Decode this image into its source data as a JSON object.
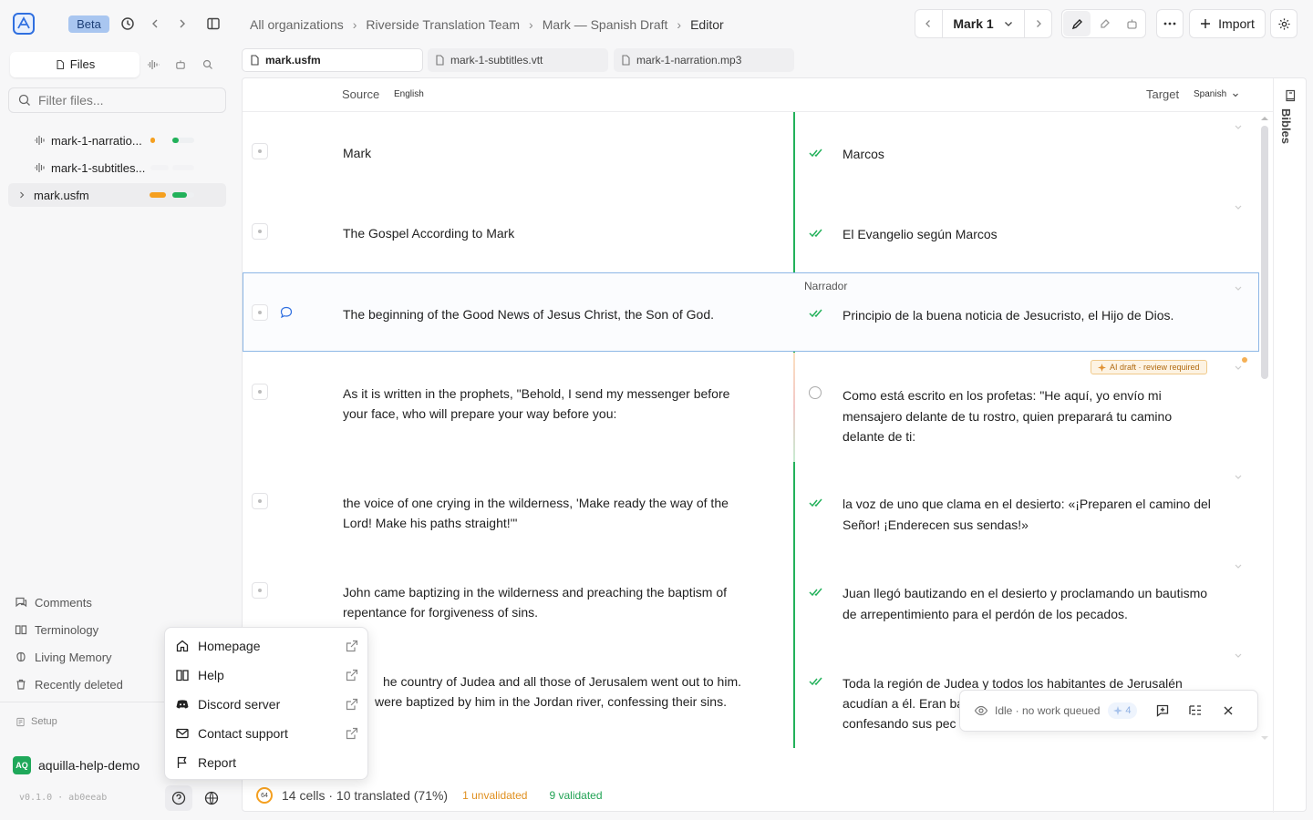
{
  "header": {
    "beta_label": "Beta",
    "breadcrumbs": [
      "All organizations",
      "Riverside Translation Team",
      "Mark — Spanish Draft",
      "Editor"
    ],
    "chapter_select": "Mark 1",
    "import_label": "Import"
  },
  "sidebar": {
    "tab_files": "Files",
    "filter_placeholder": "Filter files...",
    "files": [
      {
        "name": "mark-1-narratio..."
      },
      {
        "name": "mark-1-subtitles..."
      },
      {
        "name": "mark.usfm"
      }
    ],
    "nav": [
      {
        "label": "Comments"
      },
      {
        "label": "Terminology"
      },
      {
        "label": "Living Memory"
      },
      {
        "label": "Recently deleted"
      }
    ],
    "setup_label": "Setup",
    "workspace": {
      "badge": "AQ",
      "name": "aquilla-help-demo"
    },
    "version": "v0.1.0 · ab0eeab"
  },
  "file_tabs": [
    {
      "name": "mark.usfm"
    },
    {
      "name": "mark-1-subtitles.vtt"
    },
    {
      "name": "mark-1-narration.mp3"
    }
  ],
  "editor": {
    "source_label": "Source",
    "source_lang": "English",
    "target_label": "Target",
    "target_lang": "Spanish",
    "bibles_label": "Bibles",
    "speaker_label": "Narrador",
    "ai_badge": "AI draft · review required",
    "rows": [
      {
        "source": "Mark",
        "target": "Marcos"
      },
      {
        "source": "The Gospel According to Mark",
        "target": "El Evangelio según Marcos"
      },
      {
        "source": "The beginning of the Good News of Jesus Christ, the Son of God.",
        "target": "Principio de la buena noticia de Jesucristo, el Hijo de Dios."
      },
      {
        "source": "As it is written in the prophets, \"Behold, I send my messenger before your face, who will prepare your way before you:",
        "target": "Como está escrito en los profetas: \"He aquí, yo envío mi mensajero delante de tu rostro, quien preparará tu camino delante de ti:"
      },
      {
        "source": "the voice of one crying in the wilderness, 'Make ready the way of the Lord! Make his paths straight!'\"",
        "target": "la voz de uno que clama en el desierto: «¡Preparen el camino del Señor! ¡Enderecen sus sendas!»"
      },
      {
        "source": "John came baptizing in the wilderness and preaching the baptism of repentance for forgiveness of sins.",
        "target": "Juan llegó bautizando en el desierto y proclamando un bautismo de arrepentimiento para el perdón de los pecados."
      },
      {
        "source": "he country of Judea and all those of Jerusalem went out to him.",
        "source2": "were baptized by him in the Jordan river, confessing their sins.",
        "target": "Toda la región de Judea y todos los habitantes de Jerusalén",
        "target2": "acudían a él. Eran ba",
        "target3": "confesando sus pec"
      }
    ]
  },
  "status_popup": {
    "text": "Idle · no work queued",
    "count": "4"
  },
  "stats": {
    "progress_badge": "64",
    "summary": "14 cells · 10 translated (71%)",
    "unvalidated": "1 unvalidated",
    "validated": "9 validated"
  },
  "help_menu": [
    {
      "label": "Homepage"
    },
    {
      "label": "Help"
    },
    {
      "label": "Discord server"
    },
    {
      "label": "Contact support"
    },
    {
      "label": "Report"
    }
  ],
  "colors": {
    "accent": "#2f6fe0",
    "validated": "#22b15a",
    "warning": "#f5a020"
  }
}
